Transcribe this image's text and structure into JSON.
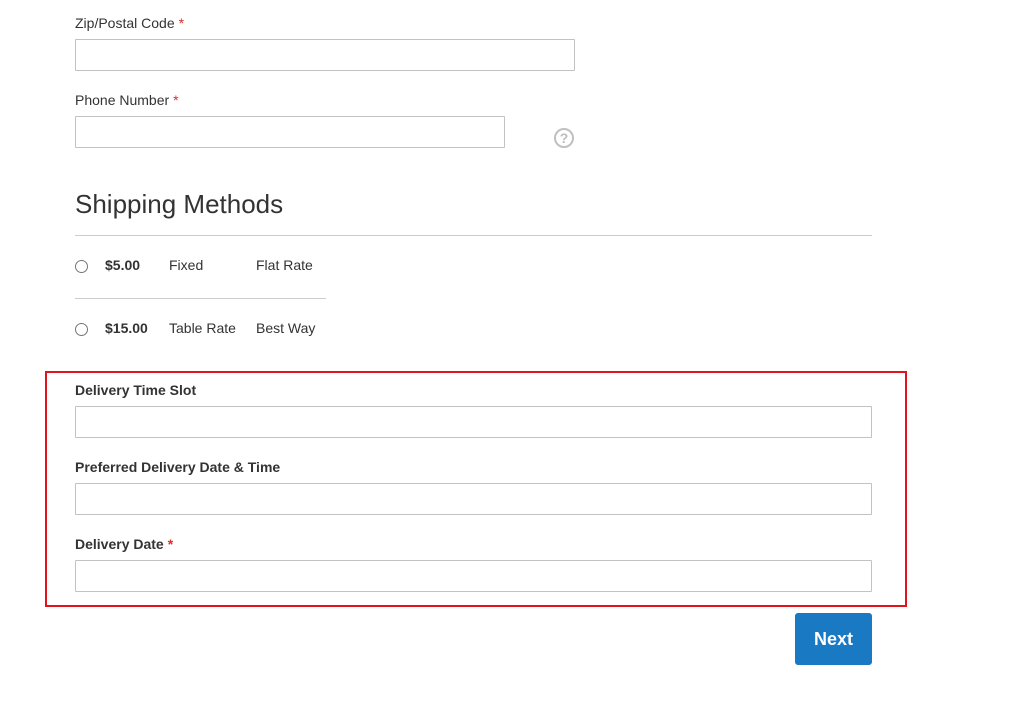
{
  "address_form": {
    "zip": {
      "label": "Zip/Postal Code",
      "required_mark": "*",
      "value": ""
    },
    "phone": {
      "label": "Phone Number",
      "required_mark": "*",
      "value": "",
      "help_icon": "question-circle-icon"
    }
  },
  "shipping_methods": {
    "title": "Shipping Methods",
    "rows": [
      {
        "price": "$5.00",
        "method": "Fixed",
        "carrier": "Flat Rate",
        "selected": false
      },
      {
        "price": "$15.00",
        "method": "Table Rate",
        "carrier": "Best Way",
        "selected": false
      }
    ]
  },
  "delivery": {
    "time_slot": {
      "label": "Delivery Time Slot",
      "value": ""
    },
    "preferred_date_time": {
      "label": "Preferred Delivery Date & Time",
      "value": ""
    },
    "date": {
      "label": "Delivery Date",
      "required_mark": "*",
      "value": ""
    },
    "highlight_color": "#e3131d"
  },
  "actions": {
    "next_label": "Next",
    "next_color": "#1979c3"
  }
}
